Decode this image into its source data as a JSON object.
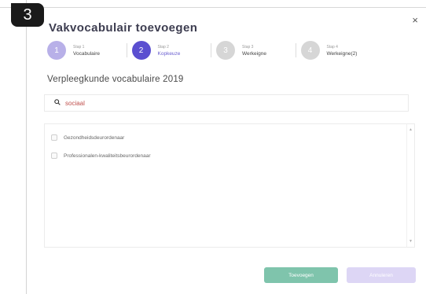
{
  "badge": "3",
  "dialog": {
    "title": "Vakvocabulair toevoegen",
    "close_icon": "×"
  },
  "steps": [
    {
      "num_label": "Stap 1",
      "name": "Vocabulaire",
      "number": "1",
      "color": "#b8b0e8"
    },
    {
      "num_label": "Stap 2",
      "name": "Kopkeuze",
      "number": "2",
      "color": "#5b4fd0"
    },
    {
      "num_label": "Stap 3",
      "name": "Werkeigne",
      "number": "3",
      "color": "#d6d6d6"
    },
    {
      "num_label": "Stap 4",
      "name": "Werkeigne(2)",
      "number": "4",
      "color": "#d6d6d6"
    }
  ],
  "section_title": "Verpleegkunde vocabulaire 2019",
  "search": {
    "icon": "search-icon",
    "value": "sociaal"
  },
  "list": {
    "items": [
      "Gezondheidsdeurordenaar",
      "Professionalen-kwaliteitsbeurordenaar"
    ]
  },
  "buttons": {
    "add": "Toevoegen",
    "cancel": "Annuleren"
  }
}
